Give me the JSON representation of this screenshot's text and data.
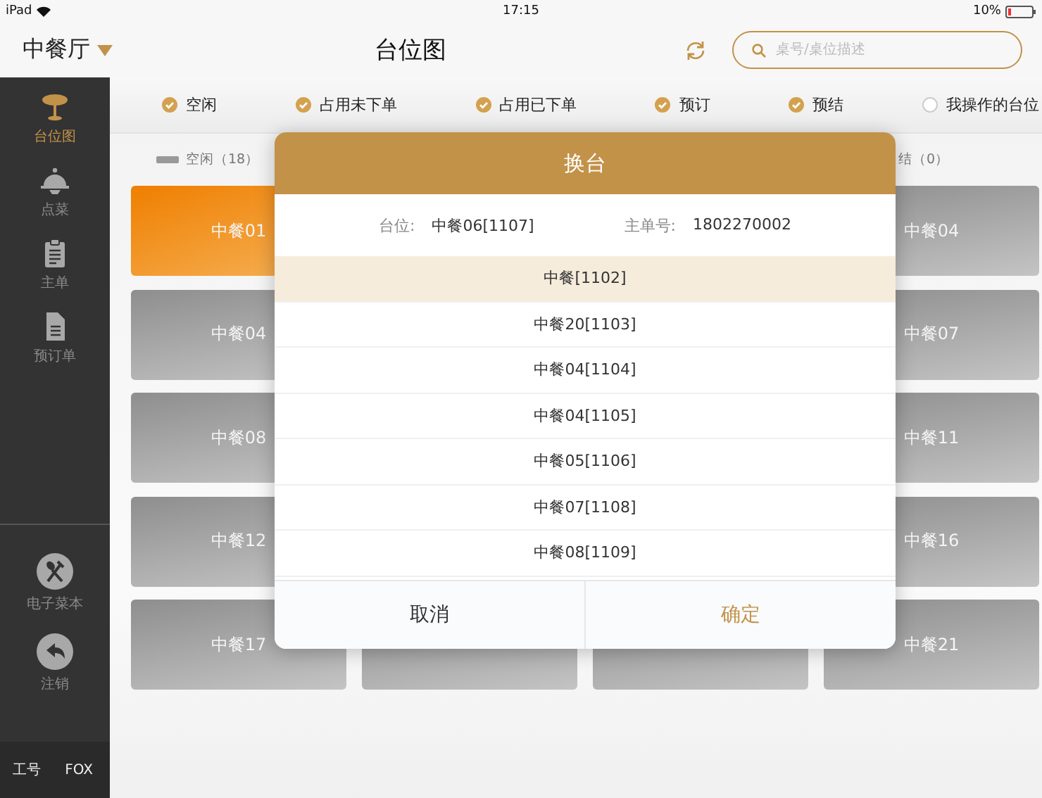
{
  "status_bar": {
    "device": "iPad",
    "time": "17:15",
    "battery": "10%"
  },
  "header": {
    "area": "中餐厅",
    "title": "台位图",
    "search": {
      "placeholder": "桌号/桌位描述"
    }
  },
  "sidebar": {
    "items": [
      {
        "label": "台位图",
        "kind": "table",
        "selected": true
      },
      {
        "label": "点菜",
        "kind": "cloche",
        "selected": false
      },
      {
        "label": "主单",
        "kind": "clipboard",
        "selected": false
      },
      {
        "label": "预订单",
        "kind": "document",
        "selected": false
      }
    ],
    "bottom_items": [
      {
        "label": "电子菜本",
        "kind": "cutlery"
      },
      {
        "label": "注销",
        "kind": "back"
      }
    ],
    "footer": {
      "label": "工号",
      "value": "FOX"
    }
  },
  "filters": [
    {
      "label": "空闲",
      "checked": true
    },
    {
      "label": "占用未下单",
      "checked": true
    },
    {
      "label": "占用已下单",
      "checked": true
    },
    {
      "label": "预订",
      "checked": true
    },
    {
      "label": "预结",
      "checked": true
    },
    {
      "label": "我操作的台位",
      "checked": false
    }
  ],
  "legend": [
    {
      "label": "空闲（18）",
      "color": "#999999"
    },
    {
      "label": "结（0）"
    }
  ],
  "tile_rows": [
    [
      {
        "label": "中餐01",
        "selected": true
      },
      {
        "label": "中餐04",
        "selected": false
      }
    ],
    [
      {
        "label": "中餐04",
        "selected": false
      },
      {
        "label": "中餐07",
        "selected": false
      }
    ],
    [
      {
        "label": "中餐08",
        "selected": false
      },
      {
        "label": "中餐11",
        "selected": false
      }
    ],
    [
      {
        "label": "中餐12",
        "selected": false
      },
      {
        "label": "中餐16",
        "selected": false
      }
    ],
    [
      {
        "label": "中餐17",
        "selected": false
      },
      {
        "selected": false
      },
      {
        "selected": false
      },
      {
        "label": "中餐21",
        "selected": false
      }
    ]
  ],
  "dialog": {
    "title": "换台",
    "info": [
      {
        "label": "台位:",
        "value": "中餐06[1107]"
      },
      {
        "label": "主单号:",
        "value": "1802270002"
      }
    ],
    "options": [
      {
        "label": "中餐[1102]",
        "selected": true
      },
      {
        "label": "中餐20[1103]",
        "selected": false
      },
      {
        "label": "中餐04[1104]",
        "selected": false
      },
      {
        "label": "中餐04[1105]",
        "selected": false
      },
      {
        "label": "中餐05[1106]",
        "selected": false
      },
      {
        "label": "中餐07[1108]",
        "selected": false
      },
      {
        "label": "中餐08[1109]",
        "selected": false
      }
    ],
    "buttons": [
      {
        "label": "取消",
        "kind": "cancel"
      },
      {
        "label": "确定",
        "kind": "confirm"
      }
    ]
  }
}
